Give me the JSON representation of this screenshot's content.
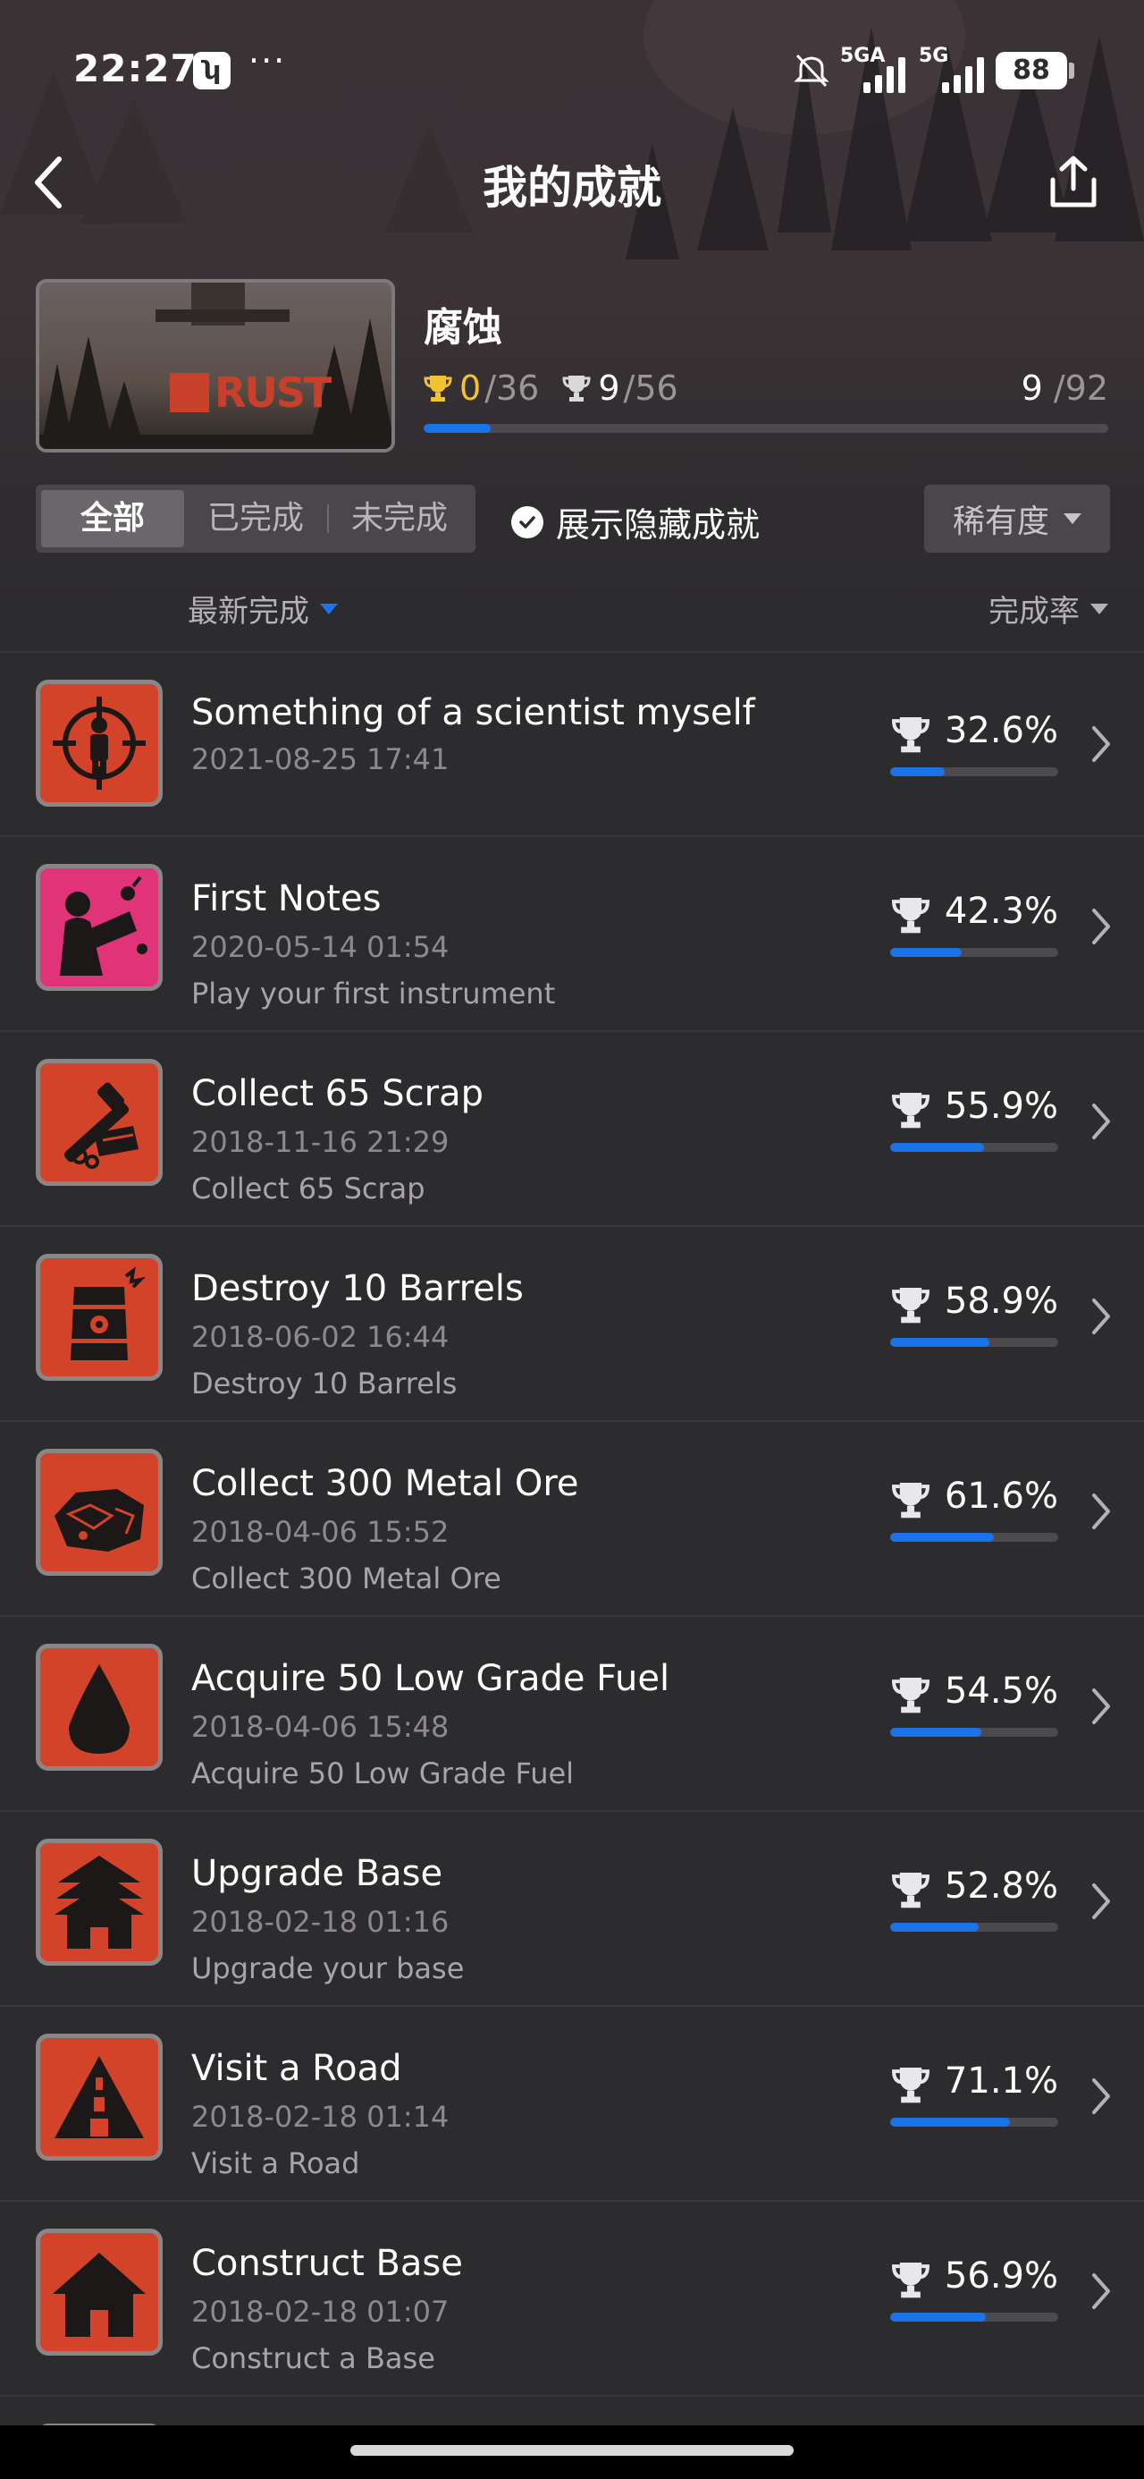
{
  "status_bar": {
    "time": "22:27",
    "app_icon_glyph": "ʮ",
    "more": "···",
    "signal_1_label": "5GA",
    "signal_2_label": "5G",
    "battery": "88",
    "icons": [
      "mute-icon",
      "signal-icon",
      "battery-icon"
    ]
  },
  "nav": {
    "title": "我的成就",
    "back_icon": "chevron-left-icon",
    "share_icon": "share-icon"
  },
  "game": {
    "name": "腐蚀",
    "cover_logo_text": "RUST",
    "gold_earned": "0",
    "gold_total": "/36",
    "silver_earned": "9",
    "silver_total": "/56",
    "unlocked": "9",
    "total": "/92",
    "progress_fraction": 0.098
  },
  "filters": {
    "tabs": [
      "全部",
      "已完成",
      "未完成"
    ],
    "active_tab": 0,
    "show_hidden_label": "展示隐藏成就",
    "show_hidden_checked": true,
    "rarity_label": "稀有度"
  },
  "sort": {
    "latest_label": "最新完成",
    "rate_label": "完成率"
  },
  "colors": {
    "accent": "#1a73e8",
    "icon_red": "#d2432a",
    "icon_pink": "#e0337a",
    "gold": "#f1c232",
    "background": "#2c2b2e"
  },
  "achievements": [
    {
      "title": "Something of a scientist myself",
      "date": "2021-08-25 17:41",
      "desc": "",
      "rate": "32.6%",
      "rate_value": 32.6,
      "icon": "crosshair-scientist-icon",
      "icon_color": "#d2432a"
    },
    {
      "title": "First Notes",
      "date": "2020-05-14 01:54",
      "desc": "Play your first instrument",
      "rate": "42.3%",
      "rate_value": 42.3,
      "icon": "instrument-player-icon",
      "icon_color": "#e0337a"
    },
    {
      "title": "Collect 65 Scrap",
      "date": "2018-11-16 21:29",
      "desc": "Collect 65 Scrap",
      "rate": "55.9%",
      "rate_value": 55.9,
      "icon": "scrap-icon",
      "icon_color": "#d2432a"
    },
    {
      "title": "Destroy 10 Barrels",
      "date": "2018-06-02 16:44",
      "desc": "Destroy 10 Barrels",
      "rate": "58.9%",
      "rate_value": 58.9,
      "icon": "barrel-icon",
      "icon_color": "#d2432a"
    },
    {
      "title": "Collect 300 Metal Ore",
      "date": "2018-04-06 15:52",
      "desc": "Collect 300 Metal Ore",
      "rate": "61.6%",
      "rate_value": 61.6,
      "icon": "metal-ore-icon",
      "icon_color": "#d2432a"
    },
    {
      "title": "Acquire 50 Low Grade Fuel",
      "date": "2018-04-06 15:48",
      "desc": "Acquire 50 Low Grade Fuel",
      "rate": "54.5%",
      "rate_value": 54.5,
      "icon": "fuel-drop-icon",
      "icon_color": "#d2432a"
    },
    {
      "title": "Upgrade Base",
      "date": "2018-02-18 01:16",
      "desc": "Upgrade your base",
      "rate": "52.8%",
      "rate_value": 52.8,
      "icon": "upgrade-base-icon",
      "icon_color": "#d2432a"
    },
    {
      "title": "Visit a Road",
      "date": "2018-02-18 01:14",
      "desc": "Visit a Road",
      "rate": "71.1%",
      "rate_value": 71.1,
      "icon": "road-icon",
      "icon_color": "#d2432a"
    },
    {
      "title": "Construct Base",
      "date": "2018-02-18 01:07",
      "desc": "Construct a Base",
      "rate": "56.9%",
      "rate_value": 56.9,
      "icon": "house-icon",
      "icon_color": "#d2432a"
    }
  ]
}
